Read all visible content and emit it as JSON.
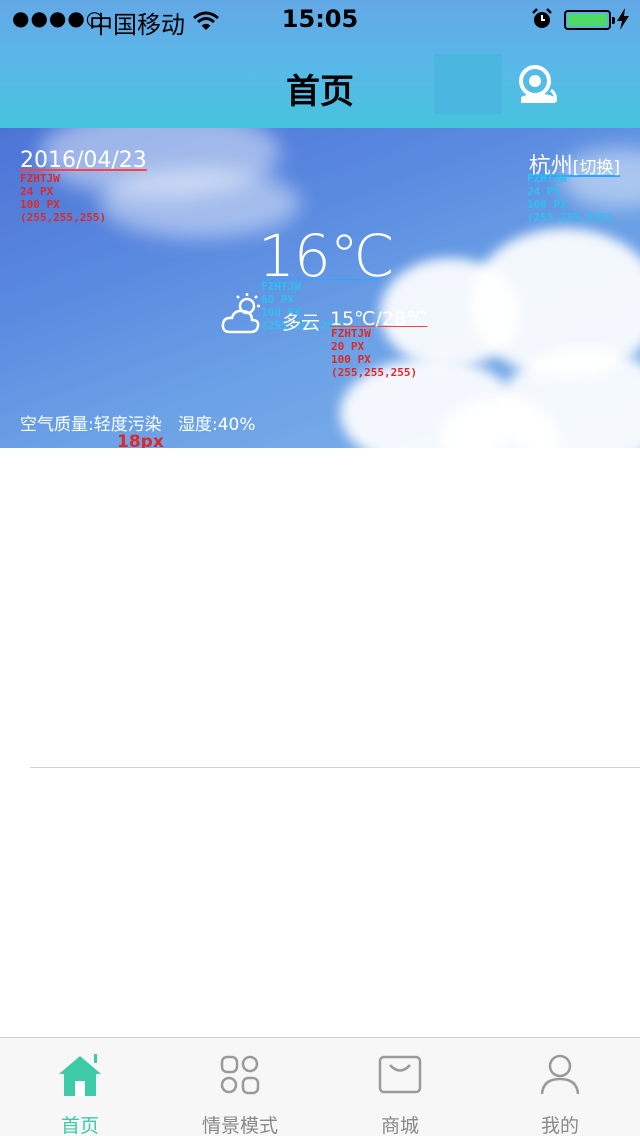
{
  "status_bar": {
    "signal": "●●●●○",
    "carrier": "中国移动",
    "time": "15:05"
  },
  "header": {
    "title": "首页"
  },
  "weather": {
    "date": "2016/04/23",
    "city": "杭州",
    "switch": "[切换]",
    "temperature": "16℃",
    "condition": "多云",
    "range": "15℃/28℃",
    "air_quality_label": "空气质量:",
    "air_quality_value": "轻度污染",
    "humidity_label": "湿度:",
    "humidity_value": "40%"
  },
  "annotations": {
    "date_spec": "FZHTJW\n24 PX\n100 PX\n(255,255,255)",
    "city_spec": "FZHTJW\n24 PX\n100 PX\n(255,255,255)",
    "temp_spec": "FZHTJW\n60 PX\n100 PX\n(255,255,255)",
    "range_spec": "FZHTJW\n20 PX\n100 PX\n(255,255,255)",
    "air_spec": "18px"
  },
  "tabs": [
    {
      "label": "首页",
      "icon": "home-icon",
      "active": true
    },
    {
      "label": "情景模式",
      "icon": "grid-icon",
      "active": false
    },
    {
      "label": "商城",
      "icon": "shopping-bag-icon",
      "active": false
    },
    {
      "label": "我的",
      "icon": "person-icon",
      "active": false
    }
  ],
  "colors": {
    "accent": "#3ec9a7",
    "header_gradient_start": "#63a8e6",
    "header_gradient_end": "#46c4dc",
    "annotation_red": "#e02828",
    "annotation_cyan": "#2ec0ee"
  }
}
